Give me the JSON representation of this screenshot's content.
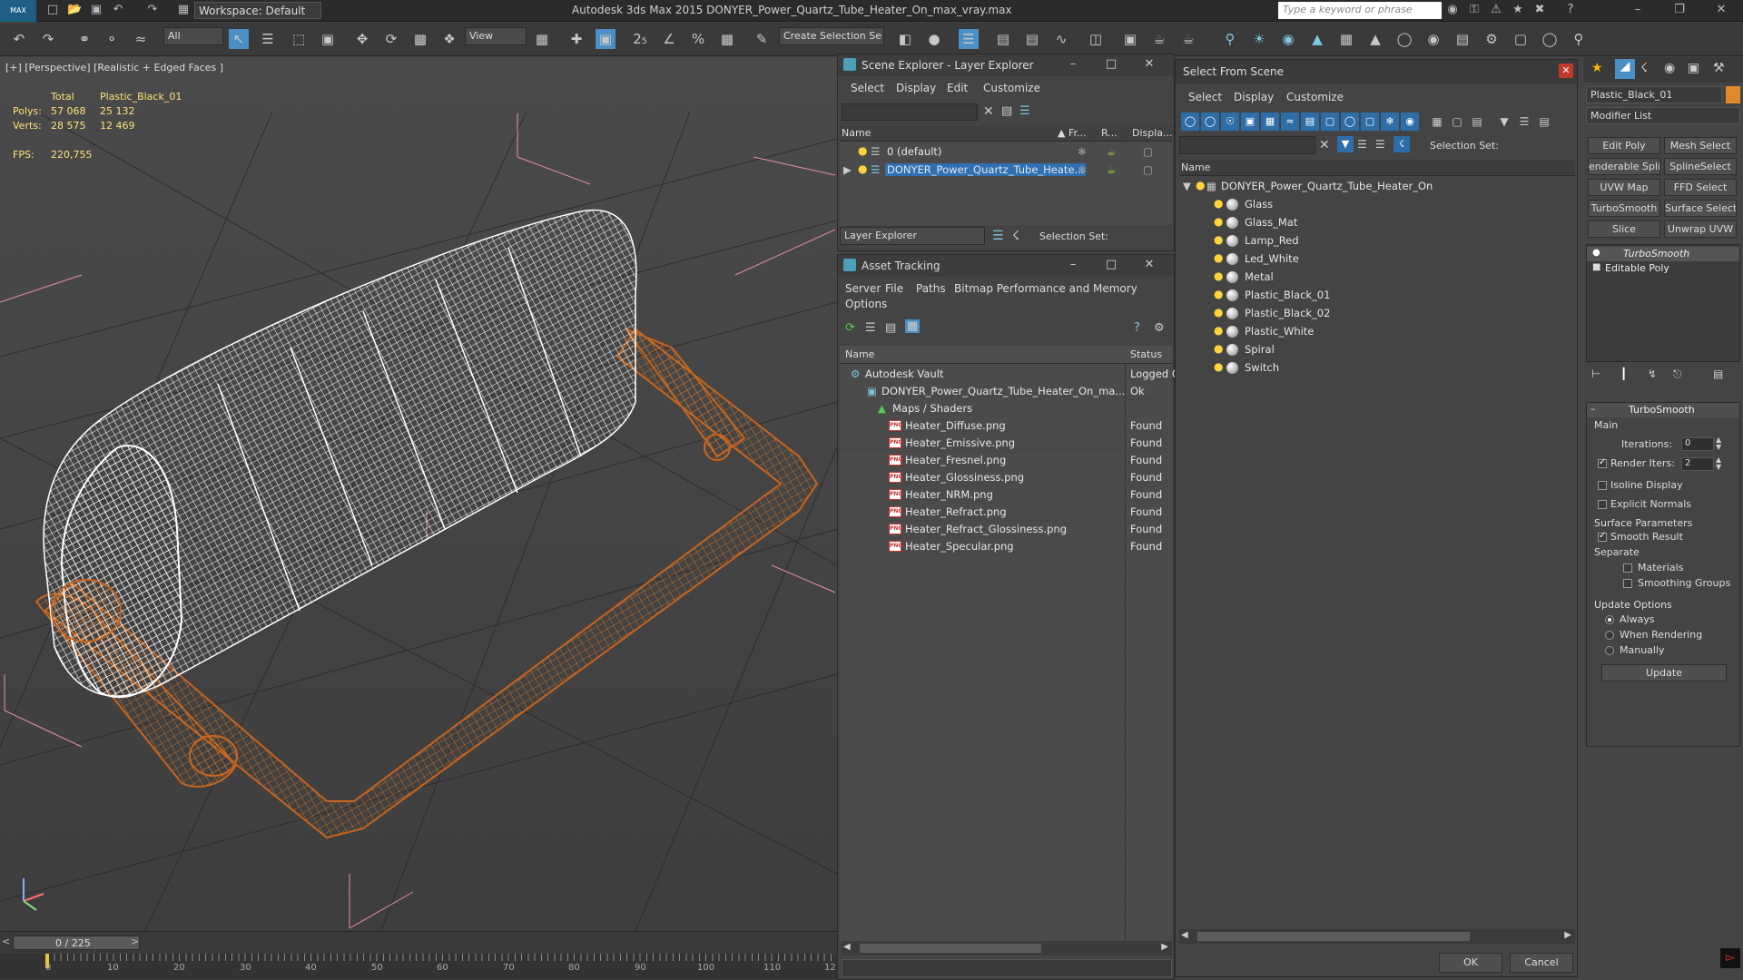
{
  "titlebar": {
    "title": "Autodesk 3ds Max  2015     DONYER_Power_Quartz_Tube_Heater_On_max_vray.max",
    "workspace": "Workspace: Default",
    "search_placeholder": "Type a keyword or phrase",
    "logo": "MAX"
  },
  "toolbar": {
    "filter_value": "All",
    "refcoord_value": "View",
    "selection_set_value": "Create Selection Se"
  },
  "viewport": {
    "label": "[+] [Perspective] [Realistic + Edged Faces ]",
    "stats": {
      "total_label": "Total",
      "object_name": "Plastic_Black_01",
      "polys_label": "Polys:",
      "polys_total": "57 068",
      "polys_object": "25 132",
      "verts_label": "Verts:",
      "verts_total": "28 575",
      "verts_object": "12 469",
      "fps_label": "FPS:",
      "fps_value": "220,755"
    }
  },
  "timeline": {
    "frame_counter": "0 / 225",
    "ticks": [
      "0",
      "10",
      "20",
      "30",
      "40",
      "50",
      "60",
      "70",
      "80",
      "90",
      "100",
      "110",
      "12"
    ]
  },
  "scene_explorer": {
    "title": "Scene Explorer - Layer Explorer",
    "menu": [
      "Select",
      "Display",
      "Edit",
      "Customize"
    ],
    "columns": {
      "name": "Name",
      "frozen": "Fr...",
      "render": "R...",
      "display": "Displa..."
    },
    "rows": [
      {
        "name": "0 (default)"
      },
      {
        "name": "DONYER_Power_Quartz_Tube_Heate..."
      }
    ],
    "footer_dropdown": "Layer Explorer",
    "selection_set_label": "Selection Set:"
  },
  "asset_tracking": {
    "title": "Asset Tracking",
    "menu": [
      "Server",
      "File",
      "Paths",
      "Bitmap Performance and Memory",
      "Options"
    ],
    "columns": {
      "name": "Name",
      "status": "Status"
    },
    "rows": [
      {
        "name": "Autodesk Vault",
        "status": "Logged O"
      },
      {
        "name": "DONYER_Power_Quartz_Tube_Heater_On_ma...",
        "status": "Ok"
      },
      {
        "name": "Maps / Shaders",
        "status": ""
      },
      {
        "name": "Heater_Diffuse.png",
        "status": "Found"
      },
      {
        "name": "Heater_Emissive.png",
        "status": "Found"
      },
      {
        "name": "Heater_Fresnel.png",
        "status": "Found"
      },
      {
        "name": "Heater_Glossiness.png",
        "status": "Found"
      },
      {
        "name": "Heater_NRM.png",
        "status": "Found"
      },
      {
        "name": "Heater_Refract.png",
        "status": "Found"
      },
      {
        "name": "Heater_Refract_Glossiness.png",
        "status": "Found"
      },
      {
        "name": "Heater_Specular.png",
        "status": "Found"
      }
    ],
    "png_badge": "PNG"
  },
  "select_from_scene": {
    "title": "Select From Scene",
    "menu": [
      "Select",
      "Display",
      "Customize"
    ],
    "selection_set_label": "Selection Set:",
    "column_name": "Name",
    "root": "DONYER_Power_Quartz_Tube_Heater_On",
    "items": [
      "Glass",
      "Glass_Mat",
      "Lamp_Red",
      "Led_White",
      "Metal",
      "Plastic_Black_01",
      "Plastic_Black_02",
      "Plastic_White",
      "Spiral",
      "Switch"
    ],
    "ok_label": "OK",
    "cancel_label": "Cancel"
  },
  "command_panel": {
    "object_name": "Plastic_Black_01",
    "modifier_list": "Modifier List",
    "buttons": [
      "Edit Poly",
      "Mesh Select",
      "enderable Splir",
      "SplineSelect",
      "UVW Map",
      "FFD Select",
      "TurboSmooth",
      "Surface Select",
      "Slice",
      "Unwrap UVW"
    ],
    "stack": [
      "TurboSmooth",
      "Editable Poly"
    ],
    "rollout_title": "TurboSmooth",
    "main_label": "Main",
    "iterations_label": "Iterations:",
    "iterations_value": "0",
    "render_iters_label": "Render Iters:",
    "render_iters_value": "2",
    "isoline_label": "Isoline Display",
    "explicit_normals_label": "Explicit Normals",
    "surface_params_label": "Surface Parameters",
    "smooth_result_label": "Smooth Result",
    "separate_label": "Separate",
    "materials_label": "Materials",
    "smoothing_groups_label": "Smoothing Groups",
    "update_options_label": "Update Options",
    "always_label": "Always",
    "when_rendering_label": "When Rendering",
    "manually_label": "Manually",
    "update_button": "Update"
  },
  "colors": {
    "accent": "#4c9fb8",
    "wire_white": "#ffffff",
    "wire_orange": "#c8641e",
    "stats_yellow": "#ffe27a"
  }
}
